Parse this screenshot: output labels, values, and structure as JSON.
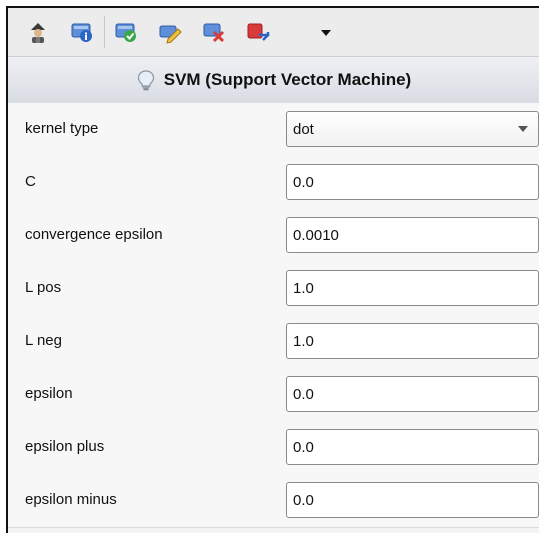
{
  "toolbar": {
    "buttons": [
      {
        "name": "wizard-icon"
      },
      {
        "name": "info-icon"
      },
      {
        "name": "apply-icon"
      },
      {
        "name": "edit-icon"
      },
      {
        "name": "delete-icon"
      },
      {
        "name": "export-icon"
      }
    ]
  },
  "operator": {
    "title": "SVM (Support Vector Machine)",
    "icon": "lightbulb-icon"
  },
  "params": [
    {
      "label": "kernel type",
      "value": "dot",
      "type": "select"
    },
    {
      "label": "C",
      "value": "0.0",
      "type": "text"
    },
    {
      "label": "convergence epsilon",
      "value": "0.0010",
      "type": "text"
    },
    {
      "label": "L pos",
      "value": "1.0",
      "type": "text"
    },
    {
      "label": "L neg",
      "value": "1.0",
      "type": "text"
    },
    {
      "label": "epsilon",
      "value": "0.0",
      "type": "text"
    },
    {
      "label": "epsilon plus",
      "value": "0.0",
      "type": "text"
    },
    {
      "label": "epsilon minus",
      "value": "0.0",
      "type": "text"
    }
  ],
  "colors": {
    "accent_green": "#3aa84a",
    "accent_red": "#d93a3a",
    "accent_blue": "#3a6fc4"
  }
}
